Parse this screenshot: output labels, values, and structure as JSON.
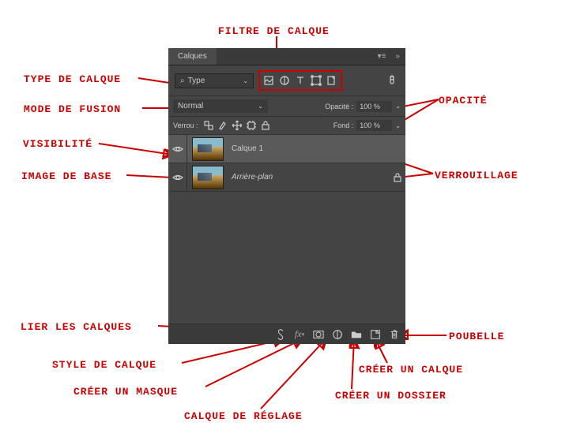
{
  "panel": {
    "tab_title": "Calques",
    "type_dropdown": {
      "label": "Type",
      "search_glyph": "⌕"
    },
    "blend_row": {
      "mode": "Normal",
      "opacity_label": "Opacité :",
      "opacity_value": "100 %"
    },
    "lock_row": {
      "label": "Verrou :",
      "fill_label": "Fond :",
      "fill_value": "100 %"
    },
    "layers": [
      {
        "name": "Calque 1",
        "selected": true,
        "locked": false,
        "italic": false
      },
      {
        "name": "Arrière-plan",
        "selected": false,
        "locked": true,
        "italic": true
      }
    ]
  },
  "annotations": {
    "filtre_de_calque": "filtre de calque",
    "type_de_calque": "type de calque",
    "mode_de_fusion": "Mode de fusion",
    "opacite": "opacité",
    "visibilite": "Visibilité",
    "verrouillage": "verrouillage",
    "image_de_base": "Image de base",
    "lier_les_calques": "lier les calques",
    "poubelle": "poubelle",
    "style_de_calque": "style de calque",
    "creer_un_calque": "créer un calque",
    "creer_un_masque": "créer un masque",
    "creer_un_dossier": "créer un dossier",
    "calque_de_reglage": "calque de réglage"
  }
}
